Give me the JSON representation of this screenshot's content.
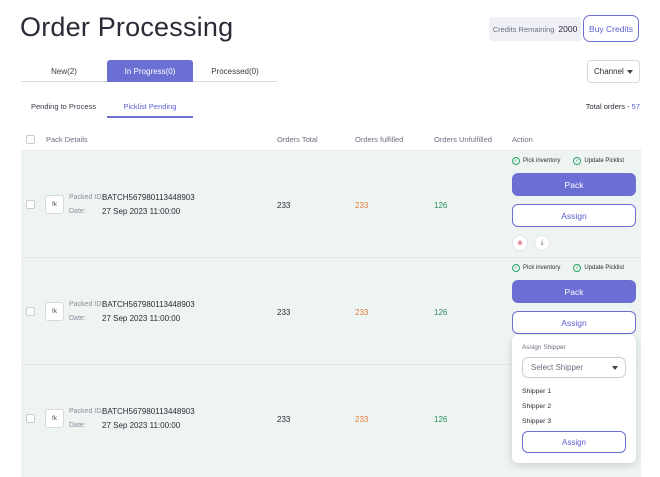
{
  "header": {
    "title": "Order Processing",
    "credits_label": "Credits Remaining",
    "credits_value": "2000",
    "buy_credits_label": "Buy Credits"
  },
  "tabs": [
    {
      "label": "New(2)"
    },
    {
      "label": "In Progress(0)"
    },
    {
      "label": "Processed(0)"
    }
  ],
  "channel_select": {
    "value": "Channel"
  },
  "subtabs": [
    {
      "label": "Pending to Process"
    },
    {
      "label": "Picklist Pending"
    }
  ],
  "total_orders": {
    "label": "Total orders - ",
    "value": "57"
  },
  "table": {
    "columns": [
      "Pack Details",
      "Orders Total",
      "Orders fulfilled",
      "Orders Unfulfilled",
      "Action"
    ],
    "rows": [
      {
        "logo": "fk",
        "packed_id_label": "Packed ID:",
        "packed_id": "BATCH567980113448903",
        "date_label": "Date:",
        "date": "27 Sep 2023  11:00:00",
        "total": "233",
        "fulfilled": "233",
        "unfulfilled": "126"
      },
      {
        "logo": "fk",
        "packed_id_label": "Packed ID:",
        "packed_id": "BATCH567980113448903",
        "date_label": "Date:",
        "date": "27 Sep 2023  11:00:00",
        "total": "233",
        "fulfilled": "233",
        "unfulfilled": "126"
      },
      {
        "logo": "fk",
        "packed_id_label": "Packed ID:",
        "packed_id": "BATCH567980113448903",
        "date_label": "Date:",
        "date": "27 Sep 2023  11:00:00",
        "total": "233",
        "fulfilled": "233",
        "unfulfilled": "126"
      }
    ]
  },
  "actions": {
    "pick_inventory": "Pick inventory",
    "update_picklist": "Update Picklist",
    "pack": "Pack",
    "assign": "Assign"
  },
  "assign_dropdown": {
    "title": "Assign Shipper",
    "placeholder": "Select Shipper",
    "options": [
      "Shipper 1",
      "Shipper 2",
      "Shipper 3"
    ],
    "button": "Assign"
  },
  "icons": {
    "check": "check-circle-icon",
    "cancel": "cancel-circle-icon",
    "download": "download-icon",
    "caret": "caret-down-icon"
  },
  "colors": {
    "accent": "#6b6fd3",
    "row_bg": "#eef4f1",
    "fulfilled": "#e07a3a",
    "unfulfilled": "#2a8a5a"
  }
}
